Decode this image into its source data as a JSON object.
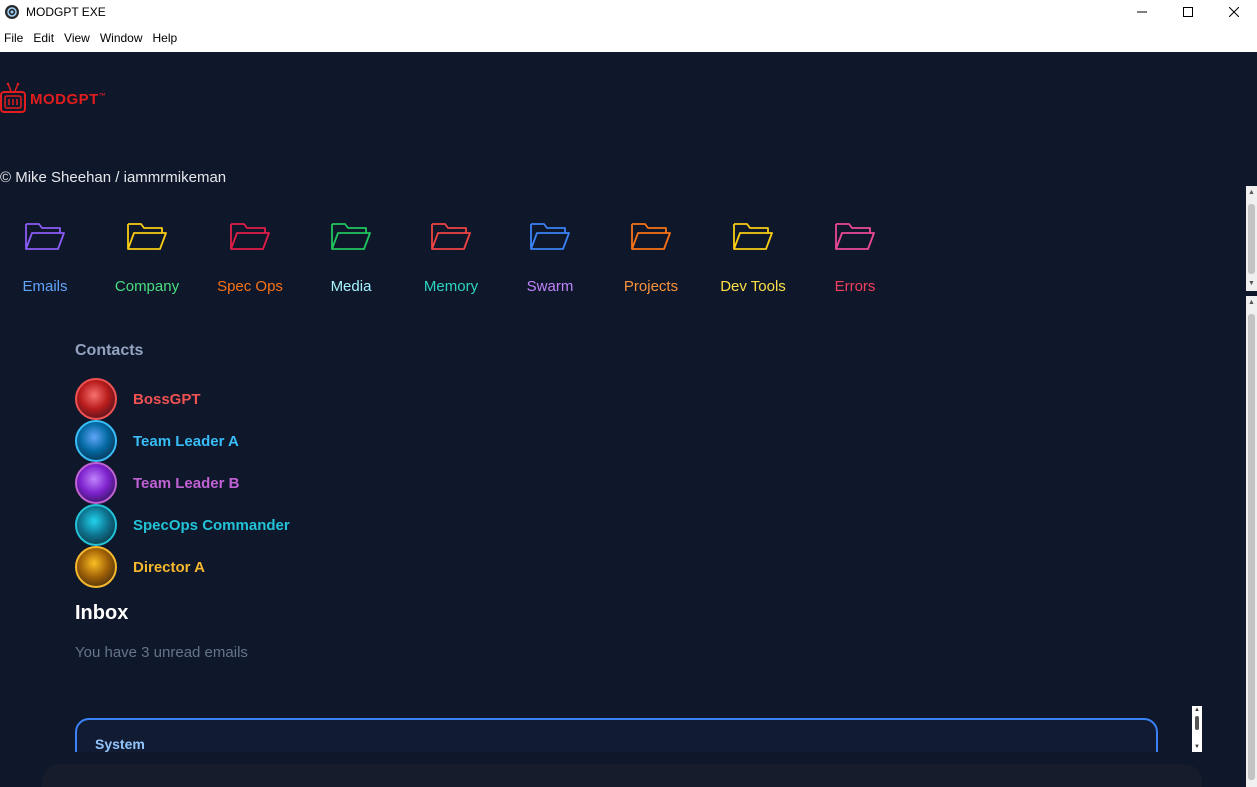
{
  "window": {
    "title": "MODGPT EXE",
    "controls": {
      "minimize": "—",
      "maximize": "☐",
      "close": "✕"
    }
  },
  "menu": [
    "File",
    "Edit",
    "View",
    "Window",
    "Help"
  ],
  "logo": {
    "text": "MODGPT",
    "tm": "™",
    "icon": "robot-tv-icon",
    "color": "#e11d1d"
  },
  "copyright": "© Mike Sheehan / iammrmikeman",
  "folders": [
    {
      "label": "Emails",
      "icon": "folder-icon",
      "icon_color": "#8b5cf6",
      "label_color": "#60a5fa"
    },
    {
      "label": "Company",
      "icon": "folder-icon",
      "icon_color": "#facc15",
      "label_color": "#4ade80"
    },
    {
      "label": "Spec Ops",
      "icon": "folder-icon",
      "icon_color": "#e11d48",
      "label_color": "#f97316"
    },
    {
      "label": "Media",
      "icon": "folder-icon",
      "icon_color": "#22c55e",
      "label_color": "#a5f3fc"
    },
    {
      "label": "Memory",
      "icon": "folder-icon",
      "icon_color": "#ef4444",
      "label_color": "#2dd4bf"
    },
    {
      "label": "Swarm",
      "icon": "folder-icon",
      "icon_color": "#3b82f6",
      "label_color": "#c084fc"
    },
    {
      "label": "Projects",
      "icon": "folder-icon",
      "icon_color": "#f97316",
      "label_color": "#fb923c"
    },
    {
      "label": "Dev Tools",
      "icon": "folder-icon",
      "icon_color": "#facc15",
      "label_color": "#fde047"
    },
    {
      "label": "Errors",
      "icon": "folder-icon",
      "icon_color": "#ec4899",
      "label_color": "#f43f5e"
    }
  ],
  "contacts": {
    "title": "Contacts",
    "items": [
      {
        "name": "BossGPT",
        "color": "#f05252",
        "avatar_fill": "#b91c1c"
      },
      {
        "name": "Team Leader A",
        "color": "#38bdf8",
        "avatar_fill": "#0369a1"
      },
      {
        "name": "Team Leader B",
        "color": "#c061d4",
        "avatar_fill": "#7e22ce"
      },
      {
        "name": "SpecOps Commander",
        "color": "#22c3d8",
        "avatar_fill": "#0e7490"
      },
      {
        "name": "Director A",
        "color": "#f5b82e",
        "avatar_fill": "#a16207"
      }
    ]
  },
  "inbox": {
    "title": "Inbox",
    "subtitle": "You have 3 unread emails",
    "emails": [
      {
        "sender": "System"
      }
    ]
  }
}
